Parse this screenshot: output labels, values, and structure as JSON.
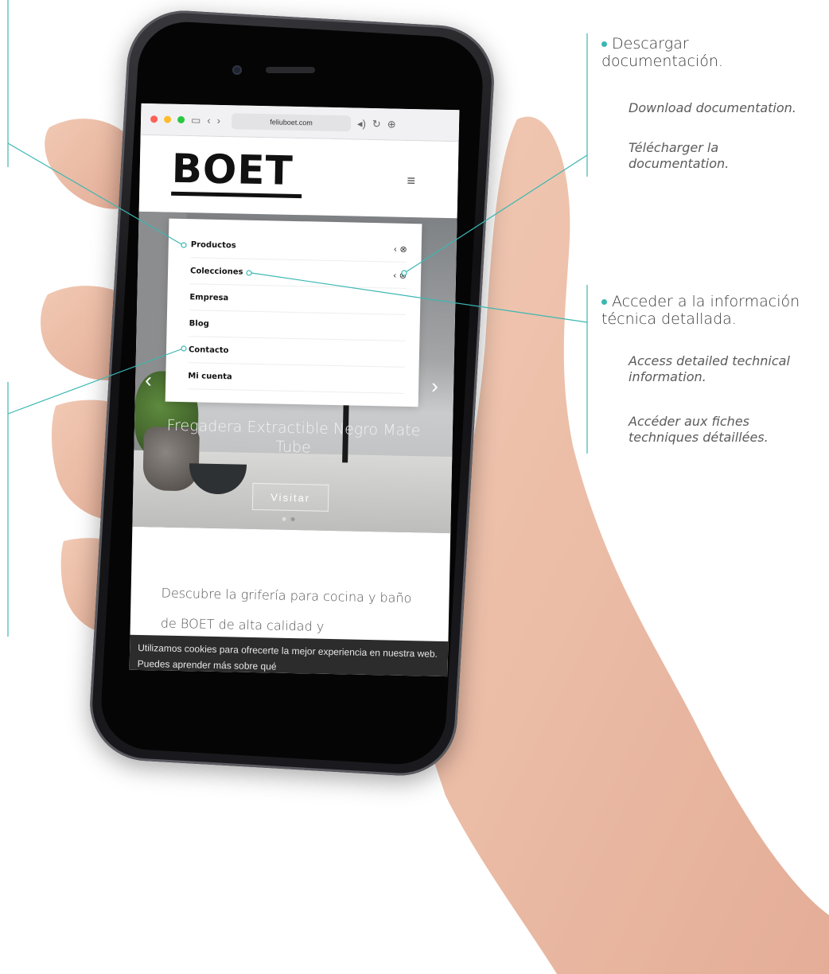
{
  "browser": {
    "url": "feliuboet.com"
  },
  "site": {
    "logo": "BOET",
    "menu_items": [
      {
        "label": "Productos",
        "has_submenu": true
      },
      {
        "label": "Colecciones",
        "has_submenu": true
      },
      {
        "label": "Empresa",
        "has_submenu": false
      },
      {
        "label": "Blog",
        "has_submenu": false
      },
      {
        "label": "Contacto",
        "has_submenu": false
      },
      {
        "label": "Mi cuenta",
        "has_submenu": false
      }
    ],
    "hero": {
      "title": "Fregadera Extractible Negro Mate Tube",
      "button": "Visitar"
    },
    "intro": "Descubre la grifería para cocina y baño de BOET de alta calidad y",
    "cookie_banner": "Utilizamos cookies para ofrecerte la mejor experiencia en nuestra web. Puedes aprender más sobre qué"
  },
  "annotations": [
    {
      "heading": "Descargar documentación.",
      "english": "Download documentation.",
      "french": "Télécharger la documentation."
    },
    {
      "heading": "Acceder a la información técnica detallada.",
      "english": "Access detailed technical information.",
      "french": "Accéder aux fiches techniques détaillées."
    }
  ],
  "colors": {
    "accent": "#3bb7b2",
    "cookie_bg": "#2c2c2c"
  }
}
